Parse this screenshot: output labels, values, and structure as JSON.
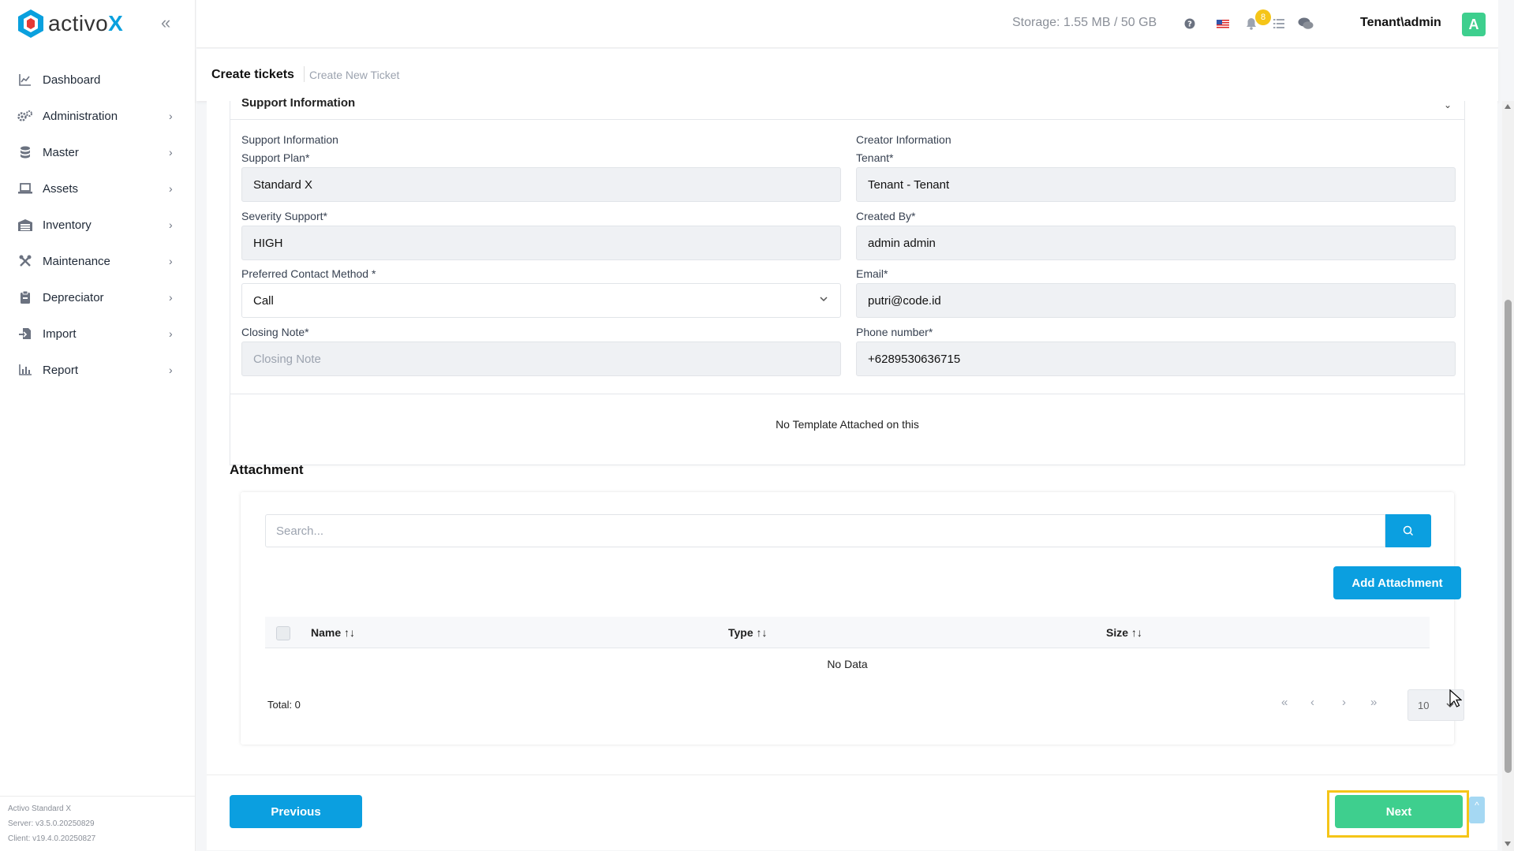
{
  "app": {
    "logo_text": "activo",
    "logo_x": "X",
    "collapse_icon": "double-chevron-left-icon"
  },
  "sidebar": {
    "items": [
      {
        "label": "Dashboard",
        "icon": "chart-line-icon"
      },
      {
        "label": "Administration",
        "icon": "gears-icon"
      },
      {
        "label": "Master",
        "icon": "database-icon"
      },
      {
        "label": "Assets",
        "icon": "laptop-icon"
      },
      {
        "label": "Inventory",
        "icon": "warehouse-icon"
      },
      {
        "label": "Maintenance",
        "icon": "tools-icon"
      },
      {
        "label": "Depreciator",
        "icon": "clipboard-icon"
      },
      {
        "label": "Import",
        "icon": "file-import-icon"
      },
      {
        "label": "Report",
        "icon": "bar-chart-icon"
      }
    ],
    "footer": {
      "edition": "Activo Standard X",
      "server": "Server: v3.5.0.20250829",
      "client": "Client: v19.4.0.20250827"
    }
  },
  "header": {
    "storage": "Storage: 1.55 MB / 50 GB",
    "notification_count": "8",
    "user": "Tenant\\admin",
    "avatar_letter": "A"
  },
  "breadcrumb": {
    "title": "Create tickets",
    "sub": "Create New Ticket"
  },
  "support_section": {
    "header": "Support Information",
    "left_group": "Support Information",
    "right_group": "Creator Information",
    "support_plan": {
      "label": "Support Plan*",
      "value": "Standard X"
    },
    "severity": {
      "label": "Severity Support*",
      "value": "HIGH"
    },
    "contact_method": {
      "label": "Preferred Contact Method *",
      "value": "Call"
    },
    "closing_note": {
      "label": "Closing Note*",
      "placeholder": "Closing Note"
    },
    "tenant": {
      "label": "Tenant*",
      "value": "Tenant - Tenant"
    },
    "created_by": {
      "label": "Created By*",
      "value": "admin admin"
    },
    "email": {
      "label": "Email*",
      "value": "putri@code.id"
    },
    "phone": {
      "label": "Phone number*",
      "value": "+6289530636715"
    }
  },
  "template_note": "No Template Attached on this",
  "attachment": {
    "title": "Attachment",
    "search_placeholder": "Search...",
    "add_button": "Add Attachment",
    "columns": [
      "Name",
      "Type",
      "Size"
    ],
    "sort_glyph": "↑↓",
    "empty_text": "No Data",
    "total": "Total: 0",
    "page_size": "10",
    "pager": {
      "first": "«",
      "prev": "‹",
      "next": "›",
      "last": "»"
    }
  },
  "actions": {
    "previous": "Previous",
    "next": "Next",
    "to_top": "^"
  },
  "colors": {
    "primary": "#0b9fe0",
    "success": "#3ecf8e",
    "highlight": "#f5c518",
    "badge": "#f5c518"
  }
}
